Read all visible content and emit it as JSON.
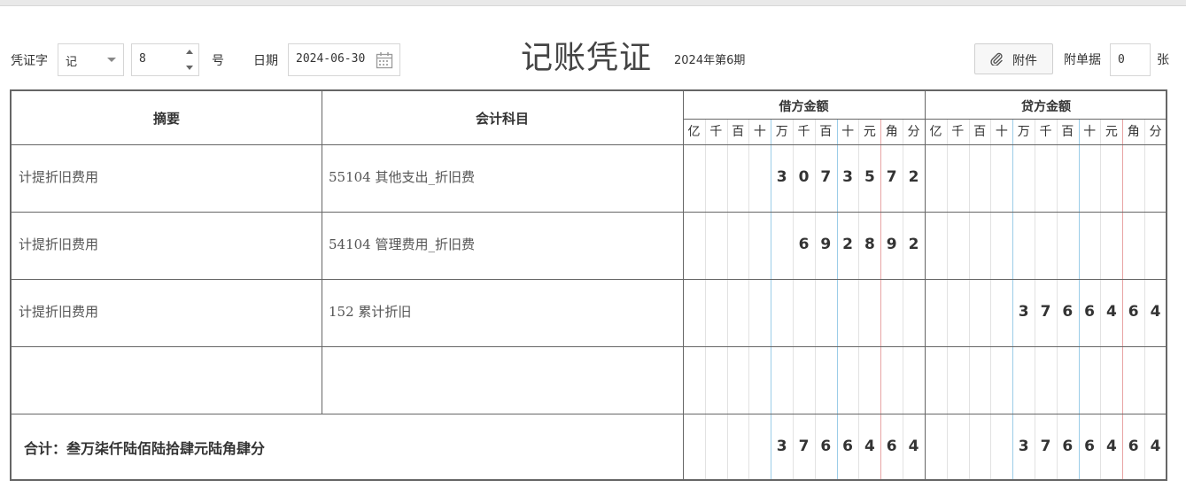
{
  "header": {
    "voucher_word_label": "凭证字",
    "voucher_word_value": "记",
    "number_value": "8",
    "number_suffix": "号",
    "date_label": "日期",
    "date_value": "2024-06-30",
    "title": "记账凭证",
    "period": "2024年第6期",
    "attach_button": "附件",
    "attach_count_label": "附单据",
    "attach_count_value": "0",
    "attach_unit": "张"
  },
  "table": {
    "col_summary": "摘要",
    "col_account": "会计科目",
    "col_debit": "借方金额",
    "col_credit": "贷方金额",
    "units": [
      "亿",
      "千",
      "百",
      "十",
      "万",
      "千",
      "百",
      "十",
      "元",
      "角",
      "分"
    ],
    "rows": [
      {
        "summary": "计提折旧费用",
        "account": "55104 其他支出_折旧费",
        "debit": "3073572",
        "credit": ""
      },
      {
        "summary": "计提折旧费用",
        "account": "54104 管理费用_折旧费",
        "debit": "692892",
        "credit": ""
      },
      {
        "summary": "计提折旧费用",
        "account": "152 累计折旧",
        "debit": "",
        "credit": "3766464"
      },
      {
        "summary": "",
        "account": "",
        "debit": "",
        "credit": ""
      }
    ],
    "total_label": "合计：叁万柒仟陆佰陆拾肆元陆角肆分",
    "total_debit": "3766464",
    "total_credit": "3766464"
  },
  "colors": {
    "border": "#666666",
    "blue_line": "#9ccde8",
    "red_line": "#e8a4a4"
  },
  "icons": {
    "calendar": "calendar-icon",
    "attach": "paperclip-icon",
    "dropdown": "chevron-down-icon"
  }
}
